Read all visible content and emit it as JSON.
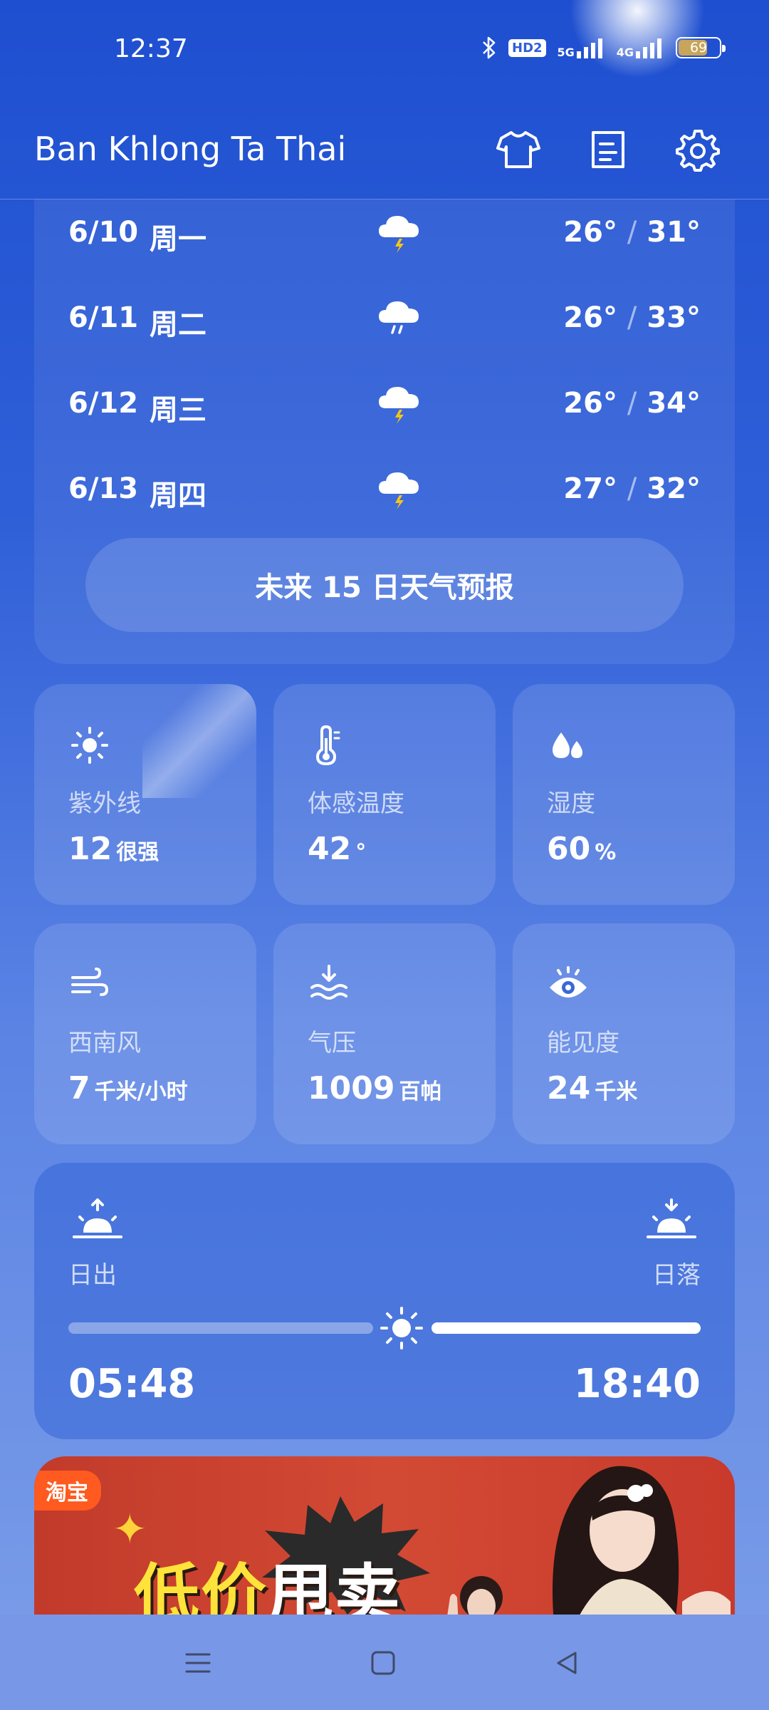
{
  "status_bar": {
    "time": "12:37",
    "hd_badge": "HD2",
    "net_5g": "5G",
    "net_4g": "4G",
    "battery_level": "69"
  },
  "header": {
    "city": "Ban Khlong Ta Thai",
    "icons": [
      "shirt-icon",
      "document-icon",
      "gear-icon"
    ]
  },
  "forecast": {
    "days": [
      {
        "date": "6/10",
        "weekday": "周一",
        "icon": "thunderstorm-icon",
        "low": "26°",
        "high": "31°"
      },
      {
        "date": "6/11",
        "weekday": "周二",
        "icon": "rain-icon",
        "low": "26°",
        "high": "33°"
      },
      {
        "date": "6/12",
        "weekday": "周三",
        "icon": "thunderstorm-icon",
        "low": "26°",
        "high": "34°"
      },
      {
        "date": "6/13",
        "weekday": "周四",
        "icon": "thunderstorm-icon",
        "low": "27°",
        "high": "32°"
      }
    ],
    "separator": "/",
    "more_button": "未来 15 日天气预报"
  },
  "details": {
    "uv": {
      "label": "紫外线",
      "value": "12",
      "unit": "很强",
      "icon": "sun-icon"
    },
    "feels_like": {
      "label": "体感温度",
      "value": "42",
      "unit": "°",
      "icon": "thermometer-icon"
    },
    "humidity": {
      "label": "湿度",
      "value": "60",
      "unit": "%",
      "icon": "droplets-icon"
    },
    "wind": {
      "label": "西南风",
      "value": "7",
      "unit": "千米/小时",
      "icon": "wind-icon"
    },
    "pressure": {
      "label": "气压",
      "value": "1009",
      "unit": "百帕",
      "icon": "pressure-icon"
    },
    "visibility": {
      "label": "能见度",
      "value": "24",
      "unit": "千米",
      "icon": "eye-icon"
    }
  },
  "sun": {
    "sunrise_label": "日出",
    "sunset_label": "日落",
    "sunrise_time": "05:48",
    "sunset_time": "18:40"
  },
  "ad": {
    "tag": "淘宝",
    "title_part1": "低价",
    "title_part2": "甩卖"
  },
  "colors": {
    "accent": "#2f5fd8",
    "lightning": "#f5c518",
    "ad_red": "#c23a2a",
    "ad_yellow": "#ffe33a"
  }
}
